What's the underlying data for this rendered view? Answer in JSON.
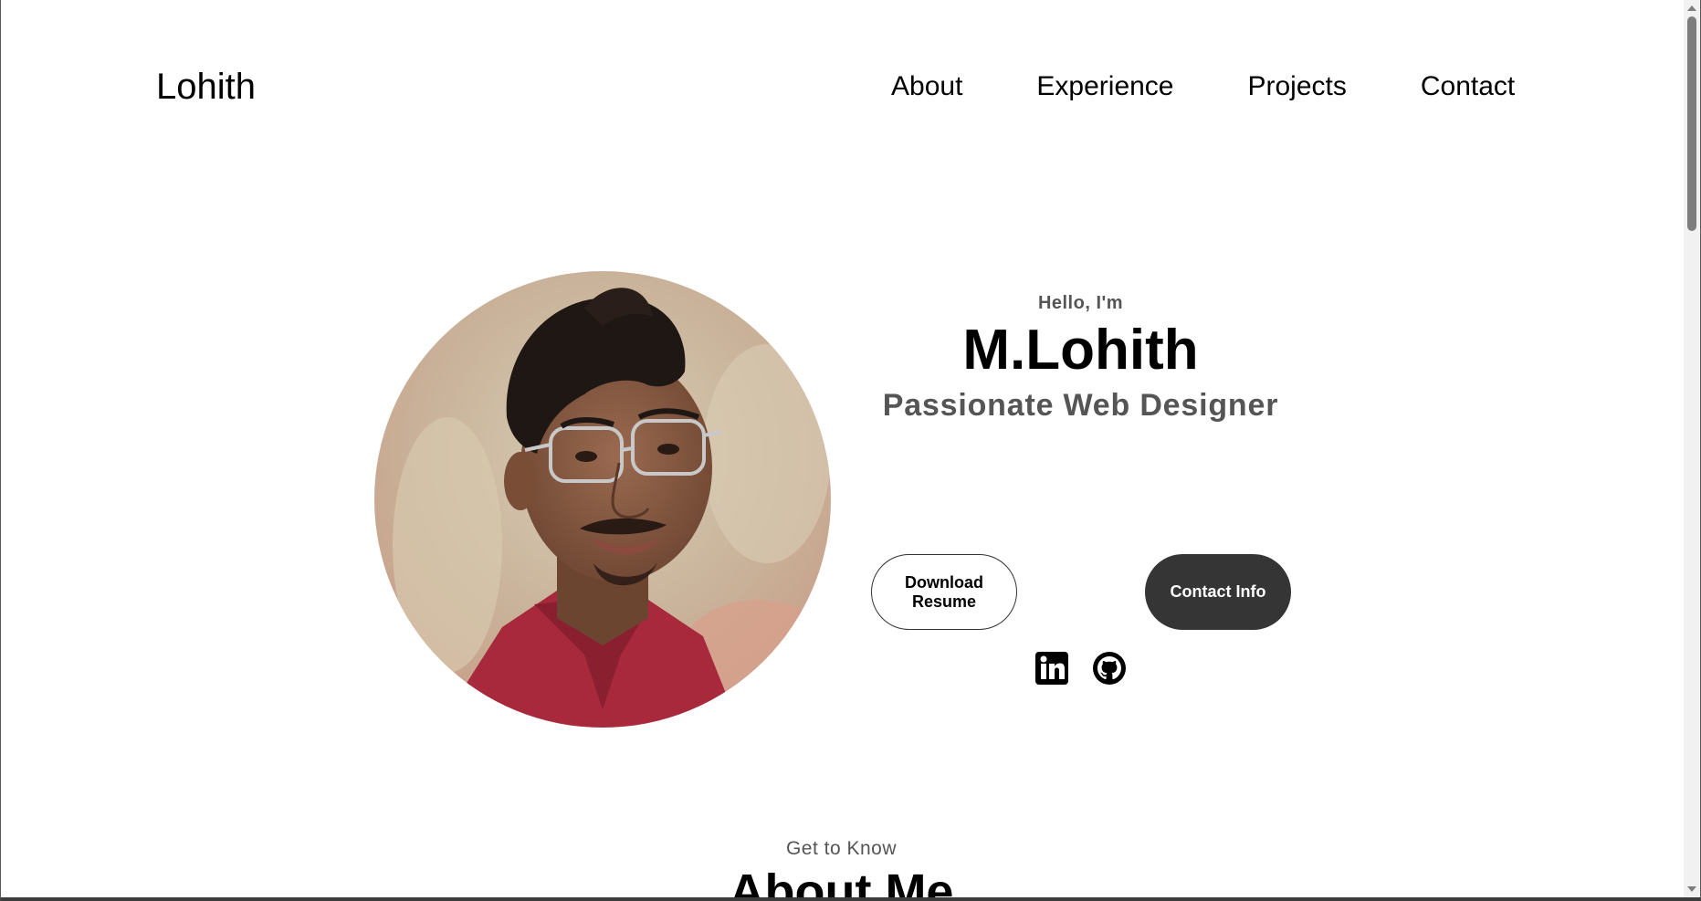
{
  "nav": {
    "logo": "Lohith",
    "links": [
      "About",
      "Experience",
      "Projects",
      "Contact"
    ]
  },
  "hero": {
    "greeting": "Hello, I'm",
    "name": "M.Lohith",
    "role": "Passionate Web Designer",
    "buttons": {
      "download_resume": "Download Resume",
      "contact_info": "Contact Info"
    },
    "socials": [
      "linkedin-icon",
      "github-icon"
    ]
  },
  "about": {
    "subtitle": "Get to Know",
    "title": "About Me"
  },
  "colors": {
    "text": "#000000",
    "muted": "#555555",
    "dark_button": "#353535",
    "background": "#ffffff"
  }
}
